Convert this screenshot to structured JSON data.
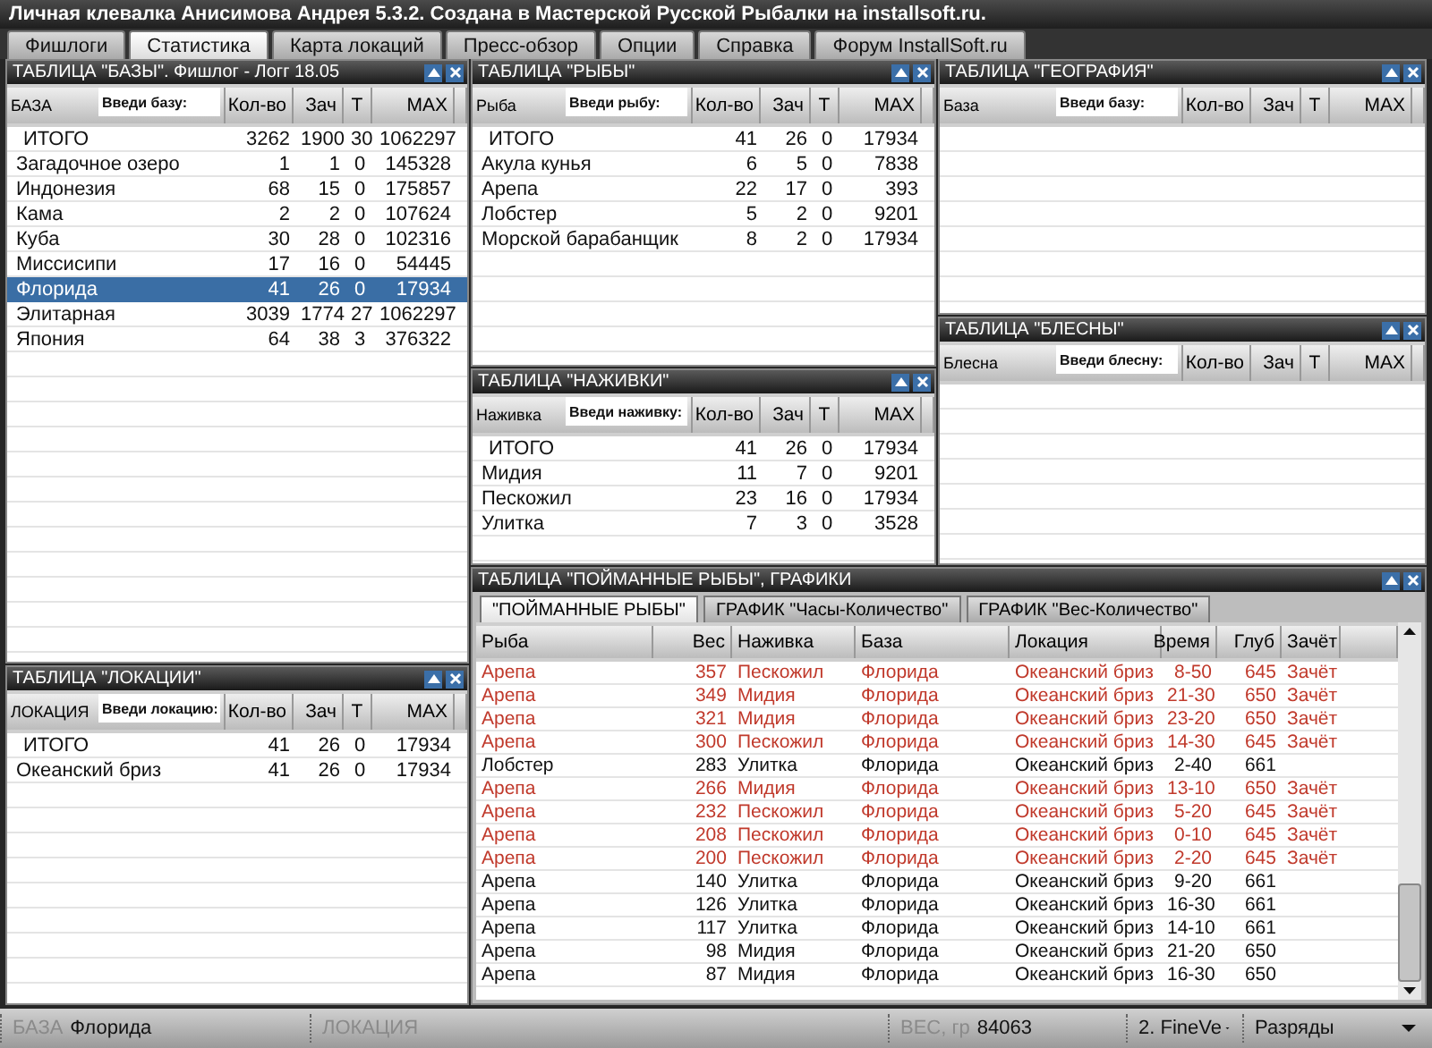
{
  "window": {
    "title": "Личная клевалка Анисимова Андрея 5.3.2. Создана в Мастерской Русской Рыбалки на installsoft.ru."
  },
  "tabs": [
    {
      "label": "Фишлоги",
      "selected": false
    },
    {
      "label": "Статистика",
      "selected": true
    },
    {
      "label": "Карта локаций",
      "selected": false
    },
    {
      "label": "Пресс-обзор",
      "selected": false
    },
    {
      "label": "Опции",
      "selected": false
    },
    {
      "label": "Справка",
      "selected": false
    },
    {
      "label": "Форум InstallSoft.ru",
      "selected": false
    }
  ],
  "bases_table": {
    "title": "ТАБЛИЦА \"БАЗЫ\". Фишлог - Логг 18.05",
    "first_column": "БАЗА",
    "placeholder": "Введи базу:",
    "columns": [
      "Кол-во",
      "Зач",
      "Т",
      "MAX"
    ],
    "total": {
      "label": "ИТОГО",
      "values": [
        "3262",
        "1900",
        "30",
        "1062297"
      ]
    },
    "rows": [
      {
        "name": "Загадочное озеро",
        "values": [
          "1",
          "1",
          "0",
          "145328"
        ],
        "selected": false
      },
      {
        "name": "Индонезия",
        "values": [
          "68",
          "15",
          "0",
          "175857"
        ],
        "selected": false
      },
      {
        "name": "Кама",
        "values": [
          "2",
          "2",
          "0",
          "107624"
        ],
        "selected": false
      },
      {
        "name": "Куба",
        "values": [
          "30",
          "28",
          "0",
          "102316"
        ],
        "selected": false
      },
      {
        "name": "Миссисипи",
        "values": [
          "17",
          "16",
          "0",
          "54445"
        ],
        "selected": false
      },
      {
        "name": "Флорида",
        "values": [
          "41",
          "26",
          "0",
          "17934"
        ],
        "selected": true
      },
      {
        "name": "Элитарная",
        "values": [
          "3039",
          "1774",
          "27",
          "1062297"
        ],
        "selected": false
      },
      {
        "name": "Япония",
        "values": [
          "64",
          "38",
          "3",
          "376322"
        ],
        "selected": false
      }
    ]
  },
  "fish_table": {
    "title": "ТАБЛИЦА \"РЫБЫ\"",
    "first_column": "Рыба",
    "placeholder": "Введи рыбу:",
    "columns": [
      "Кол-во",
      "Зач",
      "Т",
      "MAX"
    ],
    "total": {
      "label": "ИТОГО",
      "values": [
        "41",
        "26",
        "0",
        "17934"
      ]
    },
    "rows": [
      {
        "name": "Акула кунья",
        "values": [
          "6",
          "5",
          "0",
          "7838"
        ],
        "selected": false
      },
      {
        "name": "Арепа",
        "values": [
          "22",
          "17",
          "0",
          "393"
        ],
        "selected": false
      },
      {
        "name": "Лобстер",
        "values": [
          "5",
          "2",
          "0",
          "9201"
        ],
        "selected": false
      },
      {
        "name": "Морской барабанщик",
        "values": [
          "8",
          "2",
          "0",
          "17934"
        ],
        "selected": false
      }
    ]
  },
  "geography_table": {
    "title": "ТАБЛИЦА \"ГЕОГРАФИЯ\"",
    "first_column": "База",
    "placeholder": "Введи базу:",
    "columns": [
      "Кол-во",
      "Зач",
      "Т",
      "MAX"
    ]
  },
  "lures_table": {
    "title": "ТАБЛИЦА \"БЛЕСНЫ\"",
    "first_column": "Блесна",
    "placeholder": "Введи блесну:",
    "columns": [
      "Кол-во",
      "Зач",
      "Т",
      "MAX"
    ]
  },
  "baits_table": {
    "title": "ТАБЛИЦА \"НАЖИВКИ\"",
    "first_column": "Наживка",
    "placeholder": "Введи наживку:",
    "columns": [
      "Кол-во",
      "Зач",
      "Т",
      "MAX"
    ],
    "total": {
      "label": "ИТОГО",
      "values": [
        "41",
        "26",
        "0",
        "17934"
      ]
    },
    "rows": [
      {
        "name": "Мидия",
        "values": [
          "11",
          "7",
          "0",
          "9201"
        ],
        "selected": false
      },
      {
        "name": "Пескожил",
        "values": [
          "23",
          "16",
          "0",
          "17934"
        ],
        "selected": false
      },
      {
        "name": "Улитка",
        "values": [
          "7",
          "3",
          "0",
          "3528"
        ],
        "selected": false
      }
    ]
  },
  "locations_table": {
    "title": "ТАБЛИЦА \"ЛОКАЦИИ\"",
    "first_column": "ЛОКАЦИЯ",
    "placeholder": "Введи локацию:",
    "columns": [
      "Кол-во",
      "Зач",
      "Т",
      "MAX"
    ],
    "total": {
      "label": "ИТОГО",
      "values": [
        "41",
        "26",
        "0",
        "17934"
      ]
    },
    "rows": [
      {
        "name": "Океанский бриз",
        "values": [
          "41",
          "26",
          "0",
          "17934"
        ],
        "selected": false
      }
    ]
  },
  "caught_panel": {
    "title": "ТАБЛИЦА \"ПОЙМАННЫЕ РЫБЫ\", ГРАФИКИ",
    "tabs": [
      {
        "label": "\"ПОЙМАННЫЕ РЫБЫ\"",
        "selected": true
      },
      {
        "label": "ГРАФИК \"Часы-Количество\"",
        "selected": false
      },
      {
        "label": "ГРАФИК \"Вес-Количество\"",
        "selected": false
      }
    ],
    "columns": [
      "Рыба",
      "Вес",
      "Наживка",
      "База",
      "Локация",
      "Время",
      "Глуб",
      "Зачёт"
    ],
    "rows": [
      {
        "fish": "Арепа",
        "weight": "357",
        "bait": "Пескожил",
        "base": "Флорида",
        "location": "Океанский бриз",
        "time": "8-50",
        "depth": "645",
        "credit": "Зачёт",
        "counted": true
      },
      {
        "fish": "Арепа",
        "weight": "349",
        "bait": "Мидия",
        "base": "Флорида",
        "location": "Океанский бриз",
        "time": "21-30",
        "depth": "650",
        "credit": "Зачёт",
        "counted": true
      },
      {
        "fish": "Арепа",
        "weight": "321",
        "bait": "Мидия",
        "base": "Флорида",
        "location": "Океанский бриз",
        "time": "23-20",
        "depth": "650",
        "credit": "Зачёт",
        "counted": true
      },
      {
        "fish": "Арепа",
        "weight": "300",
        "bait": "Пескожил",
        "base": "Флорида",
        "location": "Океанский бриз",
        "time": "14-30",
        "depth": "645",
        "credit": "Зачёт",
        "counted": true
      },
      {
        "fish": "Лобстер",
        "weight": "283",
        "bait": "Улитка",
        "base": "Флорида",
        "location": "Океанский бриз",
        "time": "2-40",
        "depth": "661",
        "counted": false
      },
      {
        "fish": "Арепа",
        "weight": "266",
        "bait": "Мидия",
        "base": "Флорида",
        "location": "Океанский бриз",
        "time": "13-10",
        "depth": "650",
        "credit": "Зачёт",
        "counted": true
      },
      {
        "fish": "Арепа",
        "weight": "232",
        "bait": "Пескожил",
        "base": "Флорида",
        "location": "Океанский бриз",
        "time": "5-20",
        "depth": "645",
        "credit": "Зачёт",
        "counted": true
      },
      {
        "fish": "Арепа",
        "weight": "208",
        "bait": "Пескожил",
        "base": "Флорида",
        "location": "Океанский бриз",
        "time": "0-10",
        "depth": "645",
        "credit": "Зачёт",
        "counted": true
      },
      {
        "fish": "Арепа",
        "weight": "200",
        "bait": "Пескожил",
        "base": "Флорида",
        "location": "Океанский бриз",
        "time": "2-20",
        "depth": "645",
        "credit": "Зачёт",
        "counted": true
      },
      {
        "fish": "Арепа",
        "weight": "140",
        "bait": "Улитка",
        "base": "Флорида",
        "location": "Океанский бриз",
        "time": "9-20",
        "depth": "661",
        "counted": false
      },
      {
        "fish": "Арепа",
        "weight": "126",
        "bait": "Улитка",
        "base": "Флорида",
        "location": "Океанский бриз",
        "time": "16-30",
        "depth": "661",
        "counted": false
      },
      {
        "fish": "Арепа",
        "weight": "117",
        "bait": "Улитка",
        "base": "Флорида",
        "location": "Океанский бриз",
        "time": "14-10",
        "depth": "661",
        "counted": false
      },
      {
        "fish": "Арепа",
        "weight": "98",
        "bait": "Мидия",
        "base": "Флорида",
        "location": "Океанский бриз",
        "time": "21-20",
        "depth": "650",
        "counted": false
      },
      {
        "fish": "Арепа",
        "weight": "87",
        "bait": "Мидия",
        "base": "Флорида",
        "location": "Океанский бриз",
        "time": "16-30",
        "depth": "650",
        "counted": false
      }
    ]
  },
  "status_bar": [
    {
      "kind": "field",
      "label": "БАЗА",
      "value": "Флорида"
    },
    {
      "kind": "field",
      "label": "ЛОКАЦИЯ"
    },
    {
      "kind": "field",
      "label": "ВЕС, гр",
      "value": "84063"
    },
    {
      "kind": "dropdown",
      "value": "2. FineVe"
    },
    {
      "kind": "dropdown",
      "value": "Разряды"
    }
  ]
}
